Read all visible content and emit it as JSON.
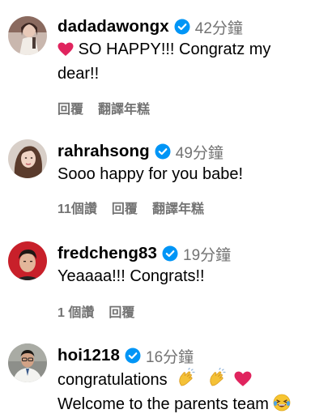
{
  "comments": [
    {
      "username": "dadadawongx",
      "time": "42分鐘",
      "text_lines": [
        "SO HAPPY!!! Congratz my",
        "dear!!"
      ],
      "reply": "回覆",
      "translate": "翻譯年糕",
      "avatar_icon": "avatar-woman-white-dress"
    },
    {
      "username": "rahrahsong",
      "time": "49分鐘",
      "text_lines": [
        "Sooo happy for you babe!"
      ],
      "likes": "11個讚",
      "reply": "回覆",
      "translate": "翻譯年糕",
      "avatar_icon": "avatar-woman-portrait"
    },
    {
      "username": "fredcheng83",
      "time": "19分鐘",
      "text_lines": [
        "Yeaaaa!!! Congrats!!"
      ],
      "likes": "1 個讚",
      "reply": "回覆",
      "avatar_icon": "avatar-man-red-background"
    },
    {
      "username": "hoi1218",
      "time": "16分鐘",
      "text_lines": [
        "congratulations",
        "Welcome to the parents team"
      ],
      "avatar_icon": "avatar-man-glasses"
    }
  ],
  "colors": {
    "verified": "#0095f6",
    "secondary_text": "#737373",
    "heart": "#e0245e"
  }
}
